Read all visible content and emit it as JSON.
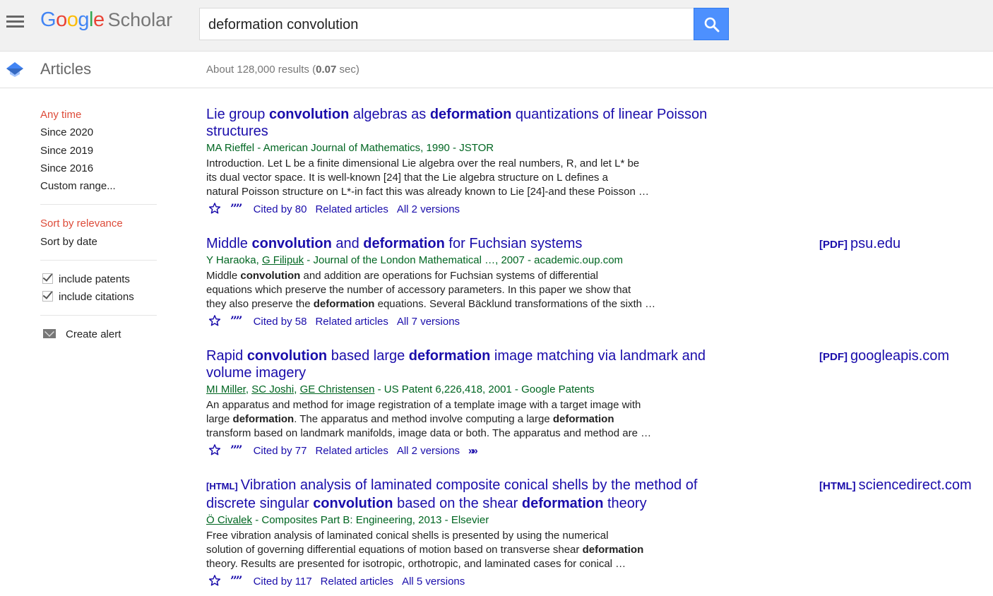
{
  "header": {
    "logo_google": [
      "G",
      "o",
      "o",
      "g",
      "l",
      "e"
    ],
    "logo_colors": [
      "#4285f4",
      "#ea4335",
      "#fbbc05",
      "#4285f4",
      "#34a853",
      "#ea4335"
    ],
    "logo_scholar": "Scholar",
    "search_value": "deformation convolution",
    "search_button_color": "#4d90fe"
  },
  "subheader": {
    "section": "Articles",
    "results_prefix": "About 128,000 results (",
    "results_time": "0.07",
    "results_suffix": " sec)"
  },
  "sidebar": {
    "time_filters": [
      "Any time",
      "Since 2020",
      "Since 2019",
      "Since 2016",
      "Custom range..."
    ],
    "sort_options": [
      "Sort by relevance",
      "Sort by date"
    ],
    "checkboxes": [
      "include patents",
      "include citations"
    ],
    "create_alert": "Create alert",
    "active_color": "#dd4b39"
  },
  "results": [
    {
      "title_parts": [
        {
          "t": "Lie group ",
          "b": false
        },
        {
          "t": "convolution",
          "b": true
        },
        {
          "t": " algebras as ",
          "b": false
        },
        {
          "t": "deformation",
          "b": true
        },
        {
          "t": " quantizations of linear Poisson structures",
          "b": false
        }
      ],
      "meta": {
        "authors": [
          {
            "name": "MA Rieffel",
            "link": false
          }
        ],
        "rest": " - American Journal of Mathematics, 1990 - JSTOR"
      },
      "snippet_lines": [
        [
          {
            "t": "Introduction. Let L be a finite dimensional Lie algebra over the real numbers, R, and let L* be",
            "b": false
          }
        ],
        [
          {
            "t": "its dual vector space. It is well-known [24] that the Lie algebra structure on L defines a",
            "b": false
          }
        ],
        [
          {
            "t": "natural Poisson structure on L*-in fact this was already known to Lie [24]-and these Poisson …",
            "b": false
          }
        ]
      ],
      "cited_by": "Cited by 80",
      "related": "Related articles",
      "versions": "All 2 versions",
      "more": false,
      "side": null
    },
    {
      "title_parts": [
        {
          "t": "Middle ",
          "b": false
        },
        {
          "t": "convolution",
          "b": true
        },
        {
          "t": " and ",
          "b": false
        },
        {
          "t": "deformation",
          "b": true
        },
        {
          "t": " for Fuchsian systems",
          "b": false
        }
      ],
      "meta": {
        "authors": [
          {
            "name": "Y Haraoka",
            "link": false
          },
          {
            "name": ", ",
            "link": false
          },
          {
            "name": "G Filipuk",
            "link": true
          }
        ],
        "rest": " - Journal of the London Mathematical …, 2007 - academic.oup.com"
      },
      "snippet_lines": [
        [
          {
            "t": "Middle ",
            "b": false
          },
          {
            "t": "convolution",
            "b": true
          },
          {
            "t": " and addition are operations for Fuchsian systems of differential",
            "b": false
          }
        ],
        [
          {
            "t": "equations which preserve the number of accessory parameters. In this paper we show that",
            "b": false
          }
        ],
        [
          {
            "t": "they also preserve the ",
            "b": false
          },
          {
            "t": "deformation",
            "b": true
          },
          {
            "t": " equations. Several Bäcklund transformations of the sixth …",
            "b": false
          }
        ]
      ],
      "cited_by": "Cited by 58",
      "related": "Related articles",
      "versions": "All 7 versions",
      "more": false,
      "side": {
        "tag": "[PDF]",
        "domain": "psu.edu"
      }
    },
    {
      "title_parts": [
        {
          "t": "Rapid ",
          "b": false
        },
        {
          "t": "convolution",
          "b": true
        },
        {
          "t": " based large ",
          "b": false
        },
        {
          "t": "deformation",
          "b": true
        },
        {
          "t": " image matching via landmark and volume imagery",
          "b": false
        }
      ],
      "meta": {
        "authors": [
          {
            "name": "MI Miller",
            "link": true
          },
          {
            "name": ", ",
            "link": false
          },
          {
            "name": "SC Joshi",
            "link": true
          },
          {
            "name": ", ",
            "link": false
          },
          {
            "name": "GE Christensen",
            "link": true
          }
        ],
        "rest": " - US Patent 6,226,418, 2001 - Google Patents"
      },
      "snippet_lines": [
        [
          {
            "t": "An apparatus and method for image registration of a template image with a target image with",
            "b": false
          }
        ],
        [
          {
            "t": "large ",
            "b": false
          },
          {
            "t": "deformation",
            "b": true
          },
          {
            "t": ". The apparatus and method involve computing a large ",
            "b": false
          },
          {
            "t": "deformation",
            "b": true
          }
        ],
        [
          {
            "t": "transform based on landmark manifolds, image data or both. The apparatus and method are …",
            "b": false
          }
        ]
      ],
      "cited_by": "Cited by 77",
      "related": "Related articles",
      "versions": "All 2 versions",
      "more": true,
      "side": {
        "tag": "[PDF]",
        "domain": "googleapis.com"
      }
    },
    {
      "title_tag": "[HTML]",
      "title_parts": [
        {
          "t": "Vibration analysis of laminated composite conical shells by the method of discrete singular ",
          "b": false
        },
        {
          "t": "convolution",
          "b": true
        },
        {
          "t": " based on the shear ",
          "b": false
        },
        {
          "t": "deformation",
          "b": true
        },
        {
          "t": " theory",
          "b": false
        }
      ],
      "meta": {
        "authors": [
          {
            "name": "Ö Civalek",
            "link": true
          }
        ],
        "rest": " - Composites Part B: Engineering, 2013 - Elsevier"
      },
      "snippet_lines": [
        [
          {
            "t": "Free vibration analysis of laminated conical shells is presented by using the numerical",
            "b": false
          }
        ],
        [
          {
            "t": "solution of governing differential equations of motion based on transverse shear ",
            "b": false
          },
          {
            "t": "deformation",
            "b": true
          }
        ],
        [
          {
            "t": "theory. Results are presented for isotropic, orthotropic, and laminated cases for conical …",
            "b": false
          }
        ]
      ],
      "cited_by": "Cited by 117",
      "related": "Related articles",
      "versions": "All 5 versions",
      "more": false,
      "side": {
        "tag": "[HTML]",
        "domain": "sciencedirect.com"
      }
    }
  ]
}
